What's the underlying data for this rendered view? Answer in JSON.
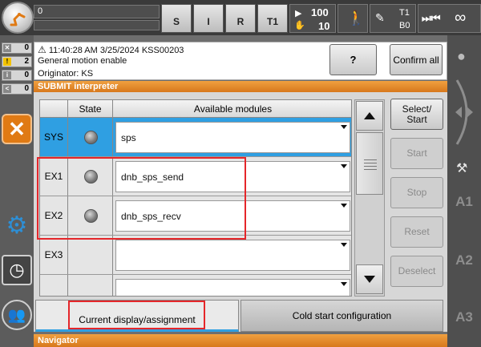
{
  "topbar": {
    "progress_value": "0",
    "progress2_value": "0",
    "buttons": [
      "S",
      "I",
      "R",
      "T1"
    ],
    "override_prog": "100",
    "override_jog": "10",
    "tool_label": "T1",
    "base_label": "B0",
    "increment": "∞"
  },
  "left": {
    "counts": [
      "0",
      "2",
      "0",
      "0"
    ]
  },
  "message": {
    "line1": "11:40:28 AM 3/25/2024 KSS00203",
    "line2": "General motion enable",
    "line3": "Originator: KS",
    "help_label": "?",
    "confirm_all": "Confirm all"
  },
  "panel": {
    "title": "SUBMIT interpreter",
    "columns": [
      "",
      "State",
      "Available modules"
    ],
    "rows": [
      {
        "name": "SYS",
        "module": "sps"
      },
      {
        "name": "EX1",
        "module": "dnb_sps_send"
      },
      {
        "name": "EX2",
        "module": "dnb_sps_recv"
      },
      {
        "name": "EX3",
        "module": ""
      },
      {
        "name": "",
        "module": ""
      }
    ],
    "actions": [
      "Select/\nStart",
      "Start",
      "Stop",
      "Reset",
      "Deselect"
    ],
    "tabs": [
      "Current display/assignment",
      "Cold start configuration"
    ]
  },
  "navigator": {
    "title": "Navigator"
  },
  "right": {
    "labels": [
      "A1",
      "A2",
      "A3"
    ]
  },
  "colors": {
    "accent": "#d7781c",
    "selected": "#2f9fe2",
    "highlight": "#e5262a"
  }
}
